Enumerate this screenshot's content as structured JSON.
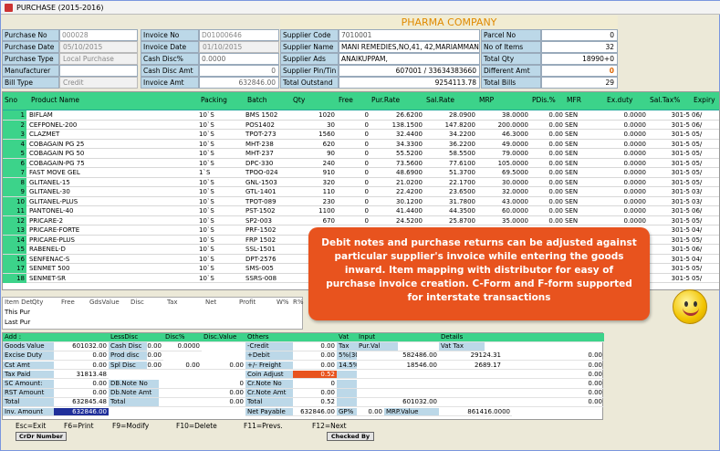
{
  "window": {
    "title": "PURCHASE (2015-2016)"
  },
  "company": "PHARMA COMPANY",
  "header": {
    "purchase_no_label": "Purchase No",
    "purchase_no": "000028",
    "purchase_date_label": "Purchase Date",
    "purchase_date": "05/10/2015",
    "purchase_type_label": "Purchase Type",
    "purchase_type": "Local Purchase",
    "manufacturer_label": "Manufacturer",
    "manufacturer": "",
    "bill_type_label": "Bill Type",
    "bill_type": "Credit",
    "invoice_no_label": "Invoice No",
    "invoice_no": "D01000646",
    "invoice_date_label": "Invoice Date",
    "invoice_date": "01/10/2015",
    "cash_disc_pct_label": "Cash Disc%",
    "cash_disc_pct": "0.0000",
    "cash_disc_amt_label": "Cash Disc Amt",
    "cash_disc_amt": "0",
    "invoice_amt_label": "Invoice Amt",
    "invoice_amt": "632846.00",
    "supplier_code_label": "Supplier Code",
    "supplier_code": "7010001",
    "supplier_name_label": "Supplier Name",
    "supplier_name": "MANI REMEDIES,NO,41, 42,MARIAMMAN",
    "supplier_ads_label": "Supplier Ads",
    "supplier_ads": "ANAIKUPPAM,",
    "supplier_pin_label": "Supplier Pin/Tin",
    "supplier_pin": "607001 / 33634383660",
    "total_outstand_label": "Total Outstand",
    "total_outstand": "9254113.78",
    "parcel_no_label": "Parcel No",
    "parcel_no": "0",
    "no_items_label": "No of Items",
    "no_items": "32",
    "total_qty_label": "Total Qty",
    "total_qty": "18990+0",
    "different_amt_label": "Different Amt",
    "different_amt": "0",
    "total_bills_label": "Total Bills",
    "total_bills": "29"
  },
  "grid": {
    "columns": [
      "Sno",
      "Product Name",
      "Packing",
      "Batch",
      "Qty",
      "Free",
      "Pur.Rate",
      "Sal.Rate",
      "MRP",
      "PDis.%",
      "MFR",
      "Ex.duty",
      "Sal.Tax%",
      "Expiry"
    ],
    "rows": [
      [
        "1",
        "BIFLAM",
        "10`S",
        "BMS 1502",
        "1020",
        "0",
        "26.6200",
        "28.0900",
        "38.0000",
        "0.00",
        "SEN",
        "0.0000",
        "301-5",
        "06/"
      ],
      [
        "2",
        "CEFPONEL-200",
        "10`S",
        "POS1402",
        "30",
        "0",
        "138.1500",
        "147.8200",
        "200.0000",
        "0.00",
        "SEN",
        "0.0000",
        "301-5",
        "06/"
      ],
      [
        "3",
        "CLAZMET",
        "10`S",
        "TPOT-273",
        "1560",
        "0",
        "32.4400",
        "34.2200",
        "46.3000",
        "0.00",
        "SEN",
        "0.0000",
        "301-5",
        "05/"
      ],
      [
        "4",
        "COBAGAIN PG 25",
        "10`S",
        "MHT-238",
        "620",
        "0",
        "34.3300",
        "36.2200",
        "49.0000",
        "0.00",
        "SEN",
        "0.0000",
        "301-5",
        "05/"
      ],
      [
        "5",
        "COBAGAIN PG 50",
        "10`S",
        "MHT-237",
        "90",
        "0",
        "55.5200",
        "58.5500",
        "79.0000",
        "0.00",
        "SEN",
        "0.0000",
        "301-5",
        "05/"
      ],
      [
        "6",
        "COBAGAIN-PG 75",
        "10`S",
        "DPC-330",
        "240",
        "0",
        "73.5600",
        "77.6100",
        "105.0000",
        "0.00",
        "SEN",
        "0.0000",
        "301-5",
        "05/"
      ],
      [
        "7",
        "FAST MOVE GEL",
        "1`S",
        "TPOO-024",
        "910",
        "0",
        "48.6900",
        "51.3700",
        "69.5000",
        "0.00",
        "SEN",
        "0.0000",
        "301-5",
        "05/"
      ],
      [
        "8",
        "GLITANEL-15",
        "10`S",
        "GNL-1503",
        "320",
        "0",
        "21.0200",
        "22.1700",
        "30.0000",
        "0.00",
        "SEN",
        "0.0000",
        "301-5",
        "05/"
      ],
      [
        "9",
        "GLITANEL-30",
        "10`S",
        "GTL-1401",
        "110",
        "0",
        "22.4200",
        "23.6500",
        "32.0000",
        "0.00",
        "SEN",
        "0.0000",
        "301-5",
        "03/"
      ],
      [
        "10",
        "GLITANEL-PLUS",
        "10`S",
        "TPOT-089",
        "230",
        "0",
        "30.1200",
        "31.7800",
        "43.0000",
        "0.00",
        "SEN",
        "0.0000",
        "301-5",
        "03/"
      ],
      [
        "11",
        "PANTONEL-40",
        "10`S",
        "PST-1502",
        "1100",
        "0",
        "41.4400",
        "44.3500",
        "60.0000",
        "0.00",
        "SEN",
        "0.0000",
        "301-5",
        "06/"
      ],
      [
        "12",
        "PRICARE-2",
        "10`S",
        "SP2-003",
        "670",
        "0",
        "24.5200",
        "25.8700",
        "35.0000",
        "0.00",
        "SEN",
        "0.0000",
        "301-5",
        "05/"
      ],
      [
        "13",
        "PRICARE-FORTE",
        "10`S",
        "PRF-1502",
        "",
        "",
        "",
        "",
        "",
        "",
        "",
        "",
        "301-5",
        "04/"
      ],
      [
        "14",
        "PRICARE-PLUS",
        "10`S",
        "FRP 1502",
        "",
        "",
        "",
        "",
        "",
        "",
        "",
        "",
        "301-5",
        "05/"
      ],
      [
        "15",
        "RABENEL-D",
        "10`S",
        "SSL-1501",
        "",
        "",
        "",
        "",
        "",
        "",
        "",
        "",
        "301-5",
        "06/"
      ],
      [
        "16",
        "SENFENAC-S",
        "10`S",
        "DPT-2576",
        "",
        "",
        "",
        "",
        "",
        "",
        "",
        "",
        "301-5",
        "04/"
      ],
      [
        "17",
        "SENMET 500",
        "10`S",
        "SMS-005",
        "",
        "",
        "",
        "",
        "",
        "",
        "",
        "",
        "301-5",
        "05/"
      ],
      [
        "18",
        "SENMET-SR",
        "10`S",
        "SSRS-008",
        "",
        "",
        "",
        "",
        "",
        "",
        "",
        "",
        "301-5",
        "05/"
      ]
    ]
  },
  "callout": "Debit notes and purchase returns can be adjusted against particular supplier's invoice while entering the goods inward. Item mapping with distributor for easy of purchase invoice creation. C-Form and F-form supported for interstate transactions",
  "item_detail": {
    "headers": [
      "Item Det",
      "Qty",
      "Free",
      "GdsValue",
      "Disc",
      "Tax",
      "Net",
      "Profit",
      "W%",
      "R%"
    ],
    "rows": [
      "This Pur",
      "Last Pur"
    ]
  },
  "totals": {
    "add_label": "Add :",
    "lessdisc_label": "LessDisc",
    "discpct_label": "Disc%",
    "discvalue_label": "Disc.Value",
    "others_label": "Others",
    "vat_label": "Vat",
    "input_label": "Input",
    "details_label": "Details",
    "goods_value_label": "Goods Value",
    "goods_value": "601032.00",
    "excise_duty_label": "Excise Duty",
    "excise_duty": "0.00",
    "cst_amt_label": "Cst Amt",
    "cst_amt": "0.00",
    "tax_paid_label": "Tax Paid",
    "tax_paid": "31813.48",
    "sc_amount_label": "SC Amount:",
    "sc_amount": "0.00",
    "rst_amount_label": "RST Amount",
    "rst_amount": "0.00",
    "total_label": "Total",
    "total": "632845.48",
    "inv_amount_label": "Inv. Amount",
    "inv_amount": "632846.00",
    "cash_disc_label": "Cash Disc",
    "cash_disc": "0.00",
    "cash_disc_pct": "0.0000",
    "prod_disc_label": "Prod disc",
    "prod_disc": "0.00",
    "spl_disc_label": "Spl Disc",
    "spl_disc": "0.00",
    "spl_disc_pct": "0.00",
    "spl_disc_val": "0.00",
    "db_note_no_label": "DB.Note No",
    "db_note_no": "0",
    "db_note_amt_label": "Db.Note Amt",
    "db_note_amt": "0.00",
    "disc_total_label": "Total",
    "disc_total": "0.00",
    "credit_label": "-Credit",
    "credit": "0.00",
    "debit_label": "+Debit",
    "debit": "0.00",
    "freight_label": "+/- Freight",
    "freight": "0.00",
    "coin_adjust_label": "Coin Adjust",
    "coin_adjust": "0.52",
    "cr_note_no_label": "Cr.Note No",
    "cr_note_no": "0",
    "cr_note_amt_label": "Cr.Note Amt",
    "cr_note_amt": "0.00",
    "others_total_label": "Total",
    "others_total": "0.52",
    "net_payable_label": "Net Payable",
    "net_payable": "632846.00",
    "vat_col_label": "Vat",
    "pur_val_label": "Pur.Val",
    "vat_tax_label": "Vat Tax",
    "vat_rows": [
      [
        "Tax",
        "",
        "",
        ""
      ],
      [
        "5%(301)",
        "582486.00",
        "29124.31",
        "0.00"
      ],
      [
        "14.5%(302)",
        "18546.00",
        "2689.17",
        "0.00"
      ],
      [
        "",
        "",
        "",
        "0.00"
      ],
      [
        "",
        "",
        "",
        "0.00"
      ],
      [
        "",
        "",
        "",
        "0.00"
      ],
      [
        "",
        "601032.00",
        "",
        "0.00"
      ]
    ],
    "gp_label": "GP%",
    "gp": "0.00",
    "mrp_value_label": "MRP.Value",
    "mrp_value": "861416.0000"
  },
  "footer": {
    "esc": "Esc=Exit",
    "f6": "F6=Print",
    "f9": "F9=Modify",
    "f10": "F10=Delete",
    "f11": "F11=Prevs.",
    "f12": "F12=Next",
    "crdr_button": "CrDr Number",
    "checked_button": "Checked By"
  }
}
